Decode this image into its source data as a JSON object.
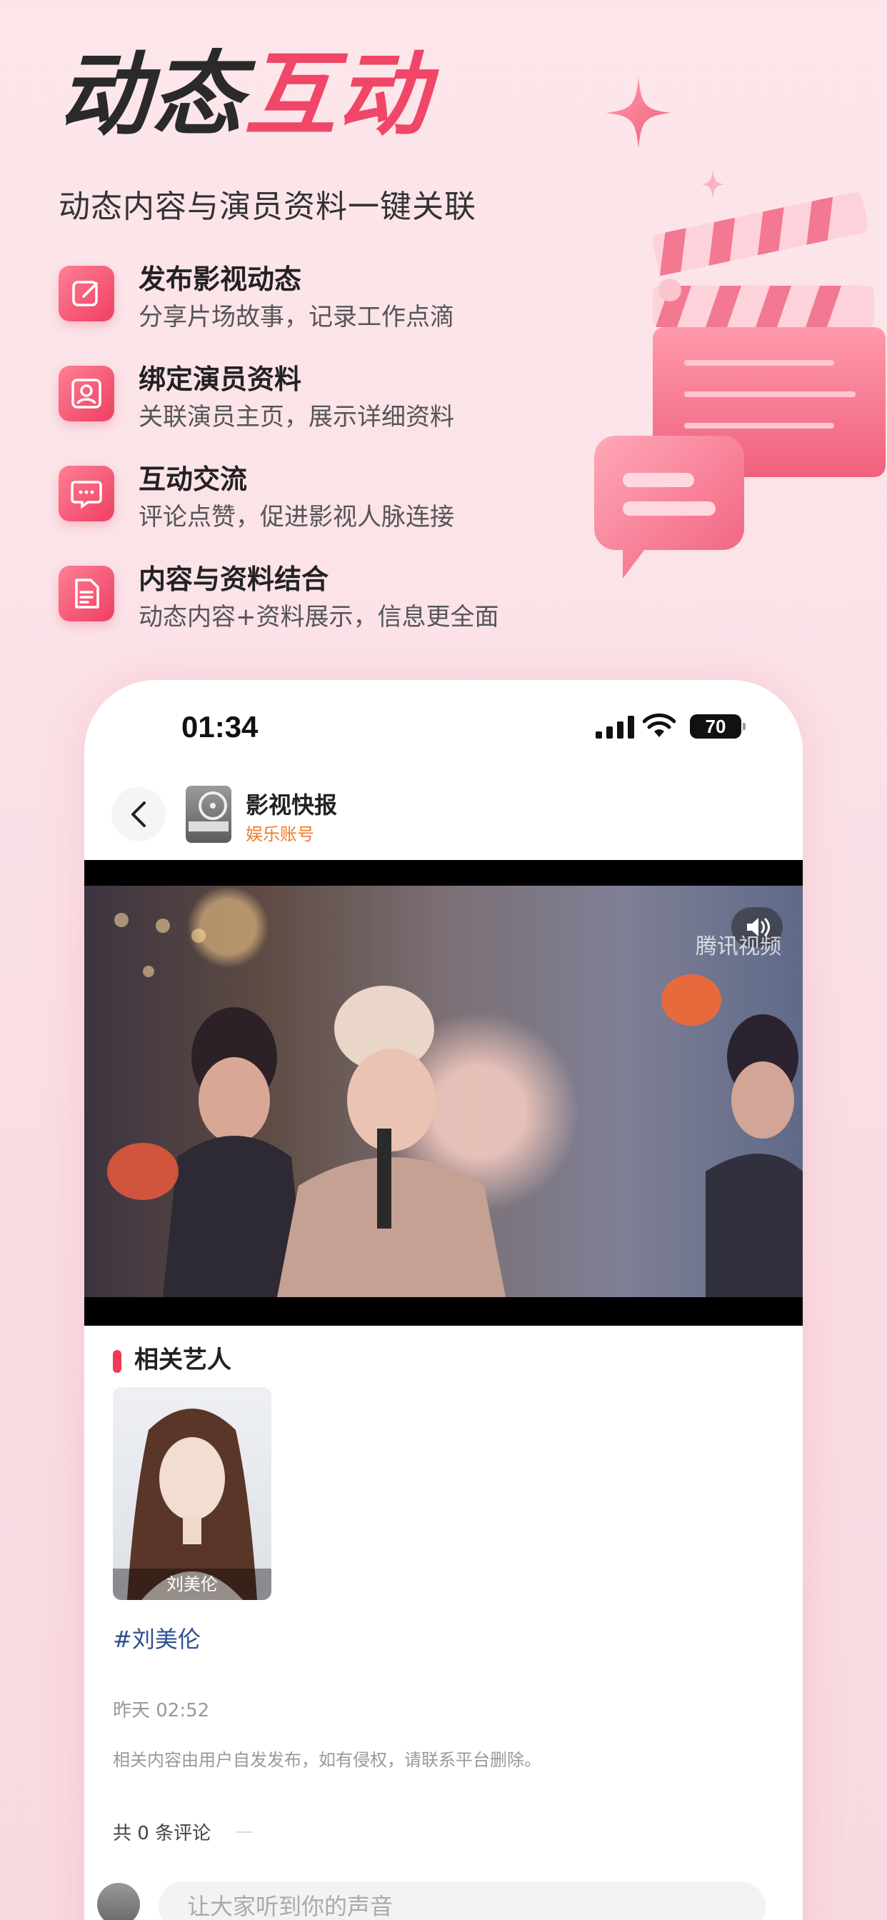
{
  "hero": {
    "title_dark": "动态",
    "title_red": "互动",
    "subtitle": "动态内容与演员资料一键关联"
  },
  "features": [
    {
      "title": "发布影视动态",
      "desc": "分享片场故事，记录工作点滴",
      "icon": "edit-icon"
    },
    {
      "title": "绑定演员资料",
      "desc": "关联演员主页，展示详细资料",
      "icon": "profile-icon"
    },
    {
      "title": "互动交流",
      "desc": "评论点赞，促进影视人脉连接",
      "icon": "chat-icon"
    },
    {
      "title": "内容与资料结合",
      "desc": "动态内容+资料展示，信息更全面",
      "icon": "document-icon"
    }
  ],
  "phone": {
    "status": {
      "time": "01:34",
      "battery": "70"
    },
    "account": {
      "name": "影视快报",
      "type": "娱乐账号"
    },
    "video": {
      "watermark": "腾讯视频"
    },
    "related": {
      "title": "相关艺人",
      "artists": [
        {
          "name": "刘美伦"
        }
      ]
    },
    "hashtag": "#刘美伦",
    "post_time": "昨天 02:52",
    "disclaimer": "相关内容由用户自发发布，如有侵权，请联系平台删除。",
    "comments": {
      "count_label": "共 0 条评论",
      "input_placeholder": "让大家听到你的声音"
    }
  },
  "colors": {
    "accent": "#f04668",
    "dark": "#2a2a2a",
    "link": "#2f4f8f",
    "account_type": "#f07a2a"
  }
}
